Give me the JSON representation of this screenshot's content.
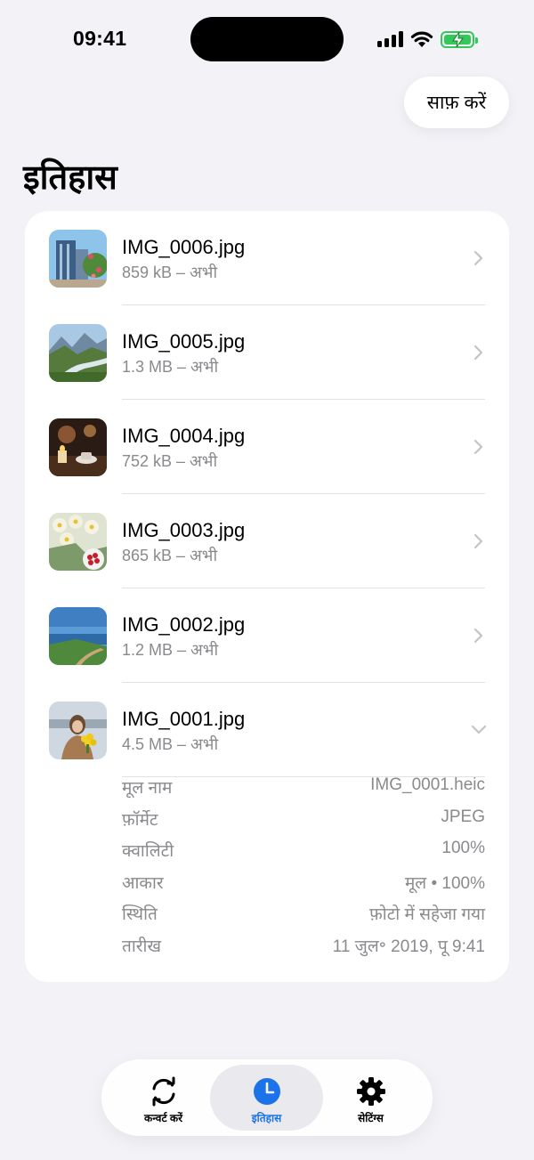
{
  "status_bar": {
    "time": "09:41"
  },
  "header": {
    "clear_label": "साफ़ करें",
    "title": "इतिहास"
  },
  "history": [
    {
      "name": "IMG_0006.jpg",
      "meta": "859 kB – अभी",
      "thumb": "city-building",
      "expanded": false
    },
    {
      "name": "IMG_0005.jpg",
      "meta": "1.3 MB – अभी",
      "thumb": "mountain-valley",
      "expanded": false
    },
    {
      "name": "IMG_0004.jpg",
      "meta": "752 kB – अभी",
      "thumb": "candle-cafe",
      "expanded": false
    },
    {
      "name": "IMG_0003.jpg",
      "meta": "865 kB – अभी",
      "thumb": "flowers-berries",
      "expanded": false
    },
    {
      "name": "IMG_0002.jpg",
      "meta": "1.2 MB – अभी",
      "thumb": "coastline",
      "expanded": false
    },
    {
      "name": "IMG_0001.jpg",
      "meta": "4.5 MB – अभी",
      "thumb": "woman-flowers",
      "expanded": true
    }
  ],
  "details": [
    {
      "label": "मूल नाम",
      "value": "IMG_0001.heic"
    },
    {
      "label": "फ़ॉर्मेट",
      "value": "JPEG"
    },
    {
      "label": "क्वालिटी",
      "value": "100%"
    },
    {
      "label": "आकार",
      "value": "मूल • 100%"
    },
    {
      "label": "स्थिति",
      "value": "फ़ोटो में सहेजा गया"
    },
    {
      "label": "तारीख",
      "value": "11 जुल॰ 2019, पू 9:41"
    }
  ],
  "tab_bar": {
    "tabs": [
      {
        "label": "कन्वर्ट करें",
        "icon": "convert-icon",
        "active": false
      },
      {
        "label": "इतिहास",
        "icon": "clock-icon",
        "active": true
      },
      {
        "label": "सेटिंग्स",
        "icon": "gear-icon",
        "active": false
      }
    ]
  },
  "colors": {
    "accent": "#1a73e8",
    "background": "#f2f2f7",
    "battery": "#34c759",
    "secondary_text": "#8a8a8e"
  }
}
